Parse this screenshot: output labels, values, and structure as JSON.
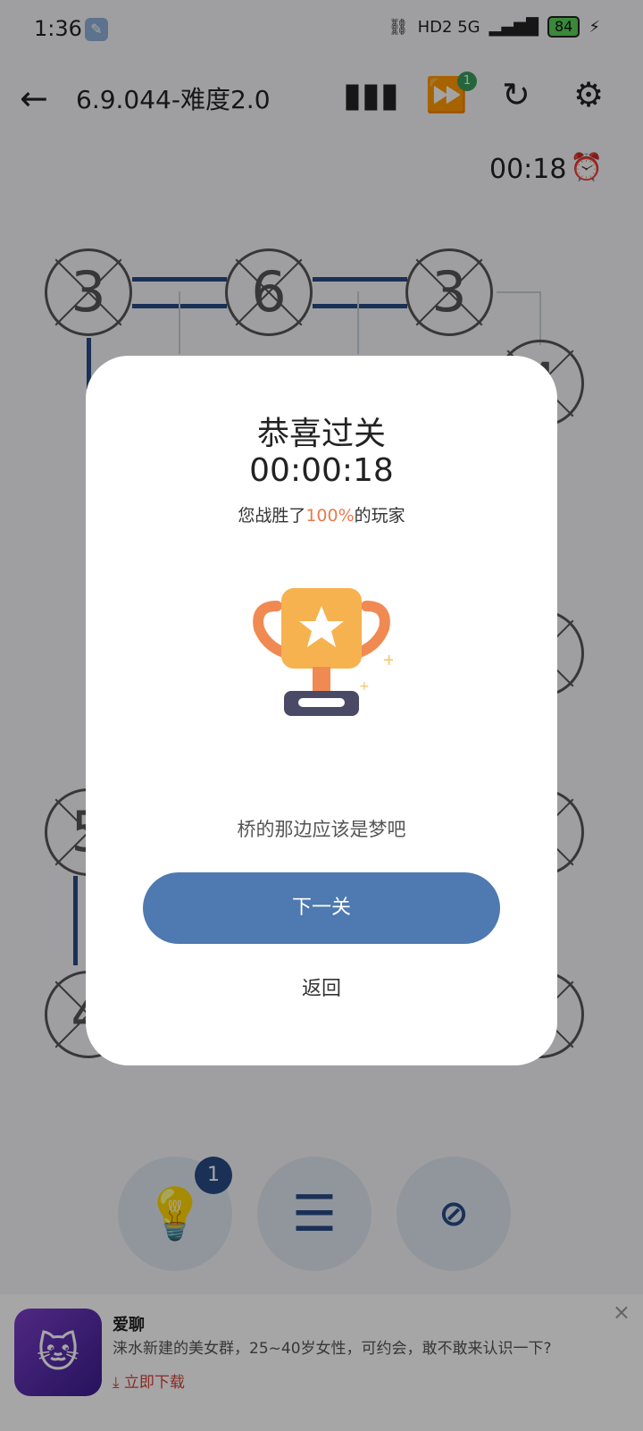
{
  "status_bar": {
    "time": "1:36",
    "right": "HD2  5G",
    "battery": "84"
  },
  "header": {
    "title": "6.9.044-难度2.0",
    "skip_badge": "1",
    "timer": "00:18"
  },
  "board": {
    "nodes": [
      "3",
      "6",
      "3",
      "4",
      "5",
      "6",
      "5",
      "4",
      "3"
    ]
  },
  "tools": {
    "hint_badge": "1"
  },
  "ad": {
    "title": "爱聊",
    "description": "涞水新建的美女群，25~40岁女性，可约会，敢不敢来认识一下?",
    "download": "立即下载",
    "close": "×"
  },
  "modal": {
    "title": "恭喜过关",
    "time": "00:00:18",
    "beat_prefix": "您战胜了",
    "beat_percent": "100%",
    "beat_suffix": "的玩家",
    "quote": "桥的那边应该是梦吧",
    "next_label": "下一关",
    "back_label": "返回"
  },
  "colors": {
    "accent": "#4e79b1",
    "board_line": "#284a85",
    "highlight": "#e97a4f"
  }
}
